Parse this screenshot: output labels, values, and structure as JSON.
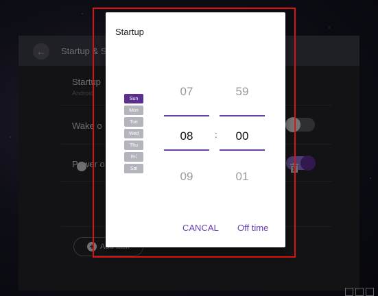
{
  "background_panel": {
    "header_title": "Startup & S",
    "rows": [
      {
        "label": "Startup",
        "sub": "Android"
      },
      {
        "label": "Wake o"
      },
      {
        "label": "Power o"
      }
    ],
    "add_task_label": "Add task"
  },
  "dialog": {
    "title": "Startup",
    "days": [
      "Sun",
      "Mon",
      "Tue",
      "Wed",
      "Thu",
      "Fri",
      "Sat"
    ],
    "selected_day": "Sun",
    "hours": {
      "prev": "07",
      "current": "08",
      "next": "09"
    },
    "separator": ":",
    "minutes": {
      "prev": "59",
      "current": "00",
      "next": "01"
    },
    "cancel_label": "CANCAL",
    "off_time_label": "Off time"
  },
  "colors": {
    "accent": "#6b3fb5",
    "selected_day": "#5c2f8f",
    "annotation": "#e01010"
  }
}
